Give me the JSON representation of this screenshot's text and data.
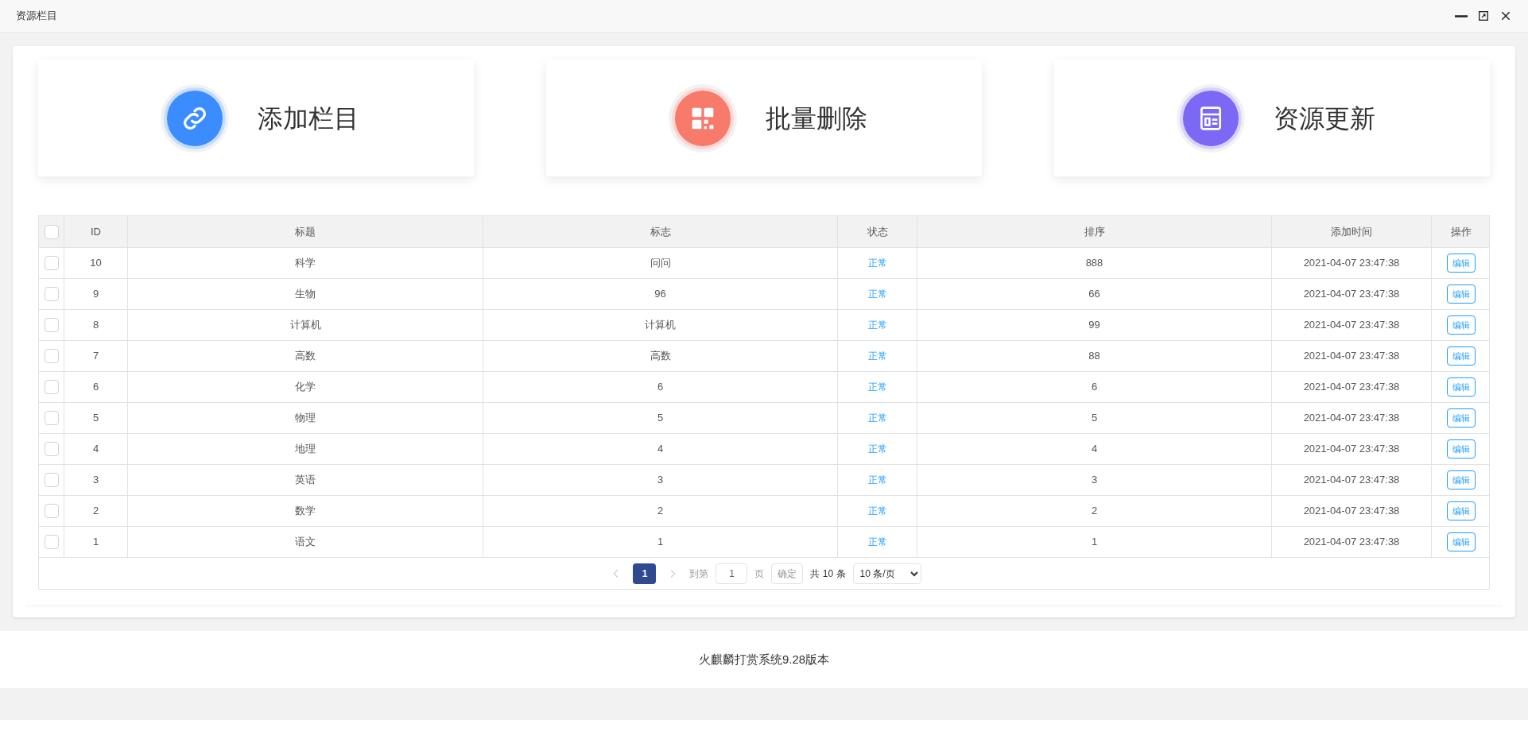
{
  "window": {
    "title": "资源栏目"
  },
  "actions": [
    {
      "label": "添加栏目",
      "kind": "link",
      "color": "#3b8cff"
    },
    {
      "label": "批量删除",
      "kind": "qrcode",
      "color": "#f77a6b"
    },
    {
      "label": "资源更新",
      "kind": "layout",
      "color": "#7b68f5"
    }
  ],
  "table": {
    "select_all_checked": false,
    "columns": [
      "ID",
      "标题",
      "标志",
      "状态",
      "排序",
      "添加时间",
      "操作"
    ],
    "rows": [
      {
        "checked": false,
        "id": "10",
        "title": "科学",
        "mark": "问问",
        "status": "正常",
        "sort": "888",
        "time": "2021-04-07 23:47:38",
        "action": "编辑"
      },
      {
        "checked": false,
        "id": "9",
        "title": "生物",
        "mark": "96",
        "status": "正常",
        "sort": "66",
        "time": "2021-04-07 23:47:38",
        "action": "编辑"
      },
      {
        "checked": false,
        "id": "8",
        "title": "计算机",
        "mark": "计算机",
        "status": "正常",
        "sort": "99",
        "time": "2021-04-07 23:47:38",
        "action": "编辑"
      },
      {
        "checked": false,
        "id": "7",
        "title": "高数",
        "mark": "高数",
        "status": "正常",
        "sort": "88",
        "time": "2021-04-07 23:47:38",
        "action": "编辑"
      },
      {
        "checked": false,
        "id": "6",
        "title": "化学",
        "mark": "6",
        "status": "正常",
        "sort": "6",
        "time": "2021-04-07 23:47:38",
        "action": "编辑"
      },
      {
        "checked": false,
        "id": "5",
        "title": "物理",
        "mark": "5",
        "status": "正常",
        "sort": "5",
        "time": "2021-04-07 23:47:38",
        "action": "编辑"
      },
      {
        "checked": false,
        "id": "4",
        "title": "地理",
        "mark": "4",
        "status": "正常",
        "sort": "4",
        "time": "2021-04-07 23:47:38",
        "action": "编辑"
      },
      {
        "checked": false,
        "id": "3",
        "title": "英语",
        "mark": "3",
        "status": "正常",
        "sort": "3",
        "time": "2021-04-07 23:47:38",
        "action": "编辑"
      },
      {
        "checked": false,
        "id": "2",
        "title": "数学",
        "mark": "2",
        "status": "正常",
        "sort": "2",
        "time": "2021-04-07 23:47:38",
        "action": "编辑"
      },
      {
        "checked": false,
        "id": "1",
        "title": "语文",
        "mark": "1",
        "status": "正常",
        "sort": "1",
        "time": "2021-04-07 23:47:38",
        "action": "编辑"
      }
    ]
  },
  "pagination": {
    "pages": [
      {
        "label": "1",
        "selected": true
      }
    ],
    "goto_label": "到第",
    "goto_value": "1",
    "page_unit": "页",
    "confirm": "确定",
    "total": "共 10 条",
    "page_size": "10 条/页"
  },
  "footer": "火麒麟打赏系统9.28版本"
}
